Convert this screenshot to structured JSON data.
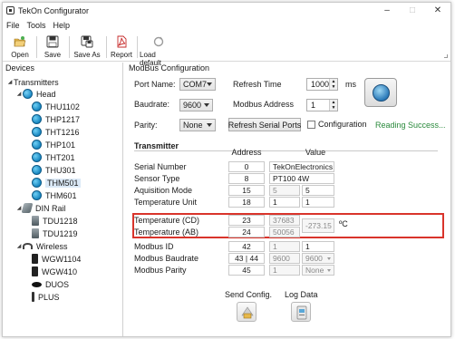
{
  "window": {
    "title": "TekOn Configurator"
  },
  "menu": [
    "File",
    "Tools",
    "Help"
  ],
  "toolbar": {
    "open": "Open",
    "save": "Save",
    "save_as": "Save As",
    "report": "Report",
    "load_default": "Load default"
  },
  "devices": {
    "title": "Devices",
    "tree": {
      "transmitters": "Transmitters",
      "head": "Head",
      "thu1102": "THU1102",
      "thp1217": "THP1217",
      "tht1216": "THT1216",
      "thp101": "THP101",
      "tht201": "THT201",
      "thu301": "THU301",
      "thm501": "THM501",
      "thm601": "THM601",
      "din_rail": "DIN Rail",
      "tdu1218": "TDU1218",
      "tdu1219": "TDU1219",
      "wireless": "Wireless",
      "wgw1104": "WGW1104",
      "wgw410": "WGW410",
      "duos": "DUOS",
      "plus": "PLUS"
    }
  },
  "modbus": {
    "title": "ModBus Configuration",
    "port_label": "Port Name:",
    "port_value": "COM7",
    "baud_label": "Baudrate:",
    "baud_value": "9600",
    "parity_label": "Parity:",
    "parity_value": "None",
    "refresh_time_label": "Refresh Time",
    "refresh_time_value": "1000",
    "refresh_time_unit": "ms",
    "modbus_address_label": "Modbus Address",
    "modbus_address_value": "1",
    "refresh_ports_label": "Refresh Serial Ports",
    "configuration_label": "Configuration",
    "status": "Reading Success...",
    "status_color": "#2a8a3c"
  },
  "transmitter": {
    "title": "Transmitter",
    "col_address": "Address",
    "col_value": "Value",
    "rows": [
      {
        "label": "Serial Number",
        "address": "0",
        "v1": "TekOnElectronics",
        "v2": ""
      },
      {
        "label": "Sensor Type",
        "address": "8",
        "v1": "PT100 4W",
        "v2": ""
      },
      {
        "label": "Aquisition Mode",
        "address": "15",
        "v1": "5",
        "v2": "5"
      },
      {
        "label": "Temperature Unit",
        "address": "18",
        "v1": "1",
        "v2": "1"
      },
      {
        "label": "Temperature (CD)",
        "address": "23",
        "v1": "37683",
        "v2": ""
      },
      {
        "label": "Temperature (AB)",
        "address": "24",
        "v1": "50056",
        "v2": ""
      },
      {
        "label": "Modbus ID",
        "address": "42",
        "v1": "1",
        "v2": "1"
      },
      {
        "label": "Modbus Baudrate",
        "address": "43 | 44",
        "v1": "9600",
        "v2": "9600"
      },
      {
        "label": "Modbus Parity",
        "address": "45",
        "v1": "1",
        "v2": "None"
      }
    ],
    "temperature_value": "-273.15",
    "temperature_unit": "ºC",
    "highlight_color": "#d9342b"
  },
  "actions": {
    "send_config": "Send Config.",
    "log_data": "Log Data"
  }
}
